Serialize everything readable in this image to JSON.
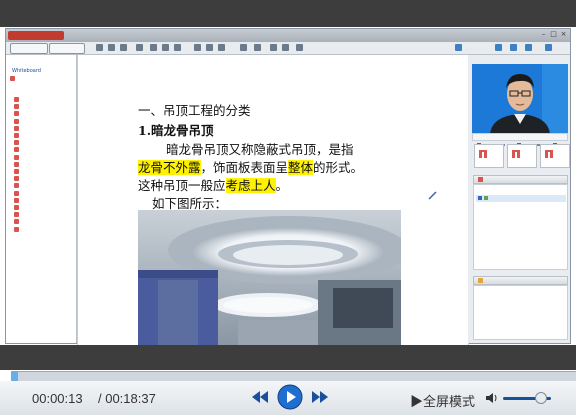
{
  "app": {
    "logo_text": "",
    "window_title": ""
  },
  "toolbar": {
    "tab_1": "",
    "tab_2": ""
  },
  "sidebar": {
    "section_1": "Whiteboard",
    "items": [
      "",
      "",
      "",
      "",
      "",
      "",
      "",
      "",
      "",
      "",
      "",
      "",
      "",
      "",
      "",
      "",
      "",
      "",
      "",
      "",
      "",
      ""
    ]
  },
  "document": {
    "heading": "一、吊顶工程的分类",
    "subheading": "1.暗龙骨吊顶",
    "line1": "暗龙骨吊顶又称隐蔽式吊顶，是指",
    "line2_hl": "龙骨不外露",
    "line2_rest_a": "，饰面板表面呈",
    "line2_hl2": "整体",
    "line2_rest_b": "的形式。",
    "line3_a": "这种吊顶一般应",
    "line3_hl": "考虑上人",
    "line3_b": "。",
    "line4": "如下图所示："
  },
  "right_panel": {
    "cam_label_1": "",
    "cam_label_2": "",
    "cam_label_3": "",
    "user_header": "",
    "user_row": "",
    "chat_header": ""
  },
  "player": {
    "current_time": "00:00:13",
    "total_time": "/ 00:18:37",
    "fullscreen_label": "▶全屏模式",
    "progress": 0.012,
    "volume": 0.8
  },
  "colors": {
    "highlight": "#fff200",
    "accent_blue": "#1c79d7",
    "brand_red": "#c23b2e"
  }
}
